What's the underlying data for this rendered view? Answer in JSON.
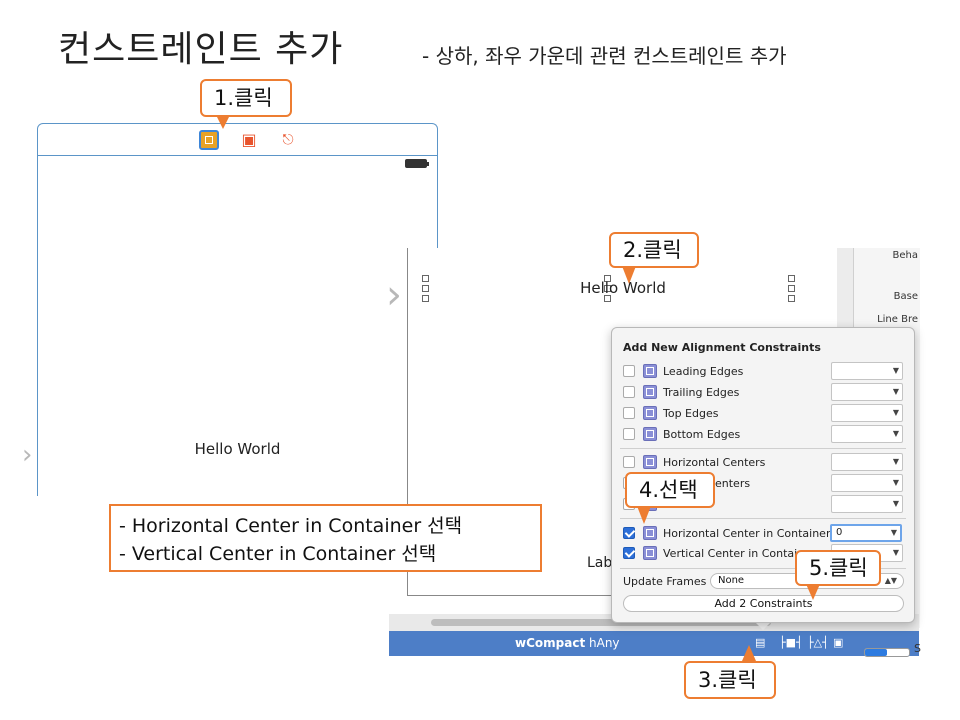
{
  "slide": {
    "title": "컨스트레인트 추가",
    "subtitle": "- 상하, 좌우 가운데 관련 컨스트레인트 추가"
  },
  "callouts": {
    "step1": "1.클릭",
    "step2": "2.클릭",
    "step3": "3.클릭",
    "step4": "4.선택",
    "step5": "5.클릭"
  },
  "storyboard": {
    "left_label": "Hello World",
    "right_label": "Hello World",
    "partial_label": "Lab",
    "size_class_w": "wCompact",
    "size_class_h": "hAny"
  },
  "inspector": {
    "items": [
      "Beha",
      "Base",
      "Line Bre"
    ],
    "partial_s": "S"
  },
  "popover": {
    "title": "Add New Alignment Constraints",
    "constraints": [
      {
        "label": "Leading Edges",
        "checked": false,
        "value": ""
      },
      {
        "label": "Trailing Edges",
        "checked": false,
        "value": ""
      },
      {
        "label": "Top Edges",
        "checked": false,
        "value": ""
      },
      {
        "label": "Bottom Edges",
        "checked": false,
        "value": ""
      },
      {
        "label": "Horizontal Centers",
        "checked": false,
        "value": ""
      },
      {
        "label": "enters",
        "checked": false,
        "value": ""
      },
      {
        "label": "",
        "checked": false,
        "value": ""
      },
      {
        "label": "Horizontal Center in Container",
        "checked": true,
        "value": "0"
      },
      {
        "label": "Vertical Center in Contai",
        "checked": true,
        "value": ""
      }
    ],
    "update_frames_label": "Update Frames",
    "update_frames_value": "None",
    "add_button_label": "Add 2 Constraints"
  },
  "note": {
    "line1": "- Horizontal  Center in Container 선택",
    "line2": "- Vertical  Center in Container 선택"
  },
  "colors": {
    "callout_border": "#ed7d31",
    "bottom_bar": "#4d7ec7",
    "checkbox_on": "#2d6fd8"
  }
}
